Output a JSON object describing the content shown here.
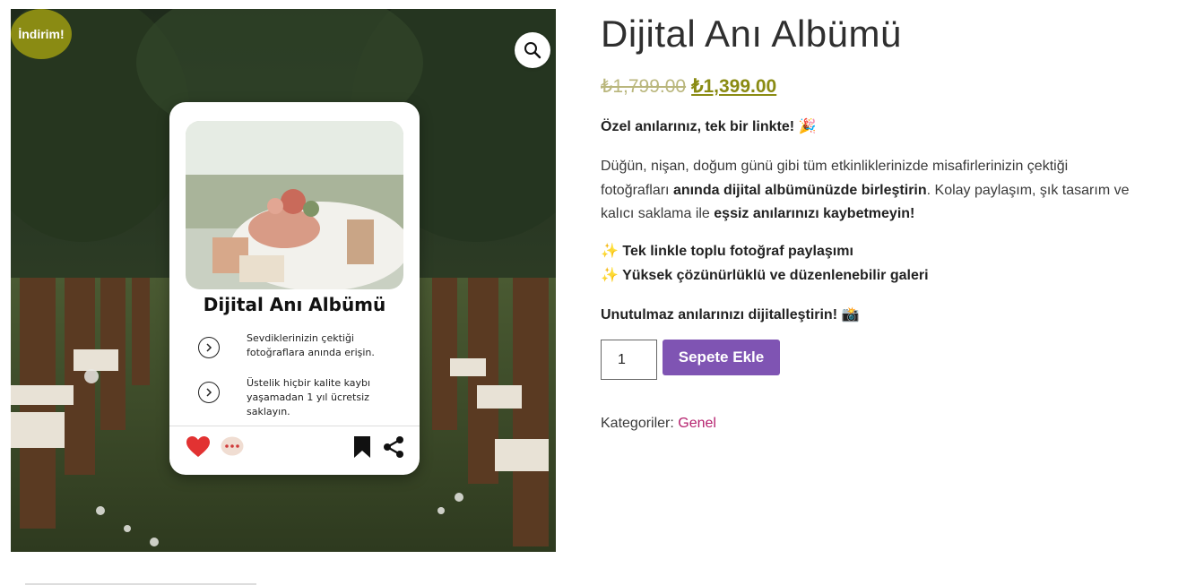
{
  "gallery": {
    "sale_badge": "İndirim!",
    "zoom_icon": "magnifier-icon",
    "card": {
      "title": "Dijital Anı Albümü",
      "features": [
        {
          "icon": "chevron-right-circle-icon",
          "text": "Sevdiklerinizin çektiği fotoğraflara anında erişin."
        },
        {
          "icon": "chevron-right-circle-icon",
          "text": "Üstelik hiçbir kalite kaybı yaşamadan 1 yıl ücretsiz saklayın."
        }
      ],
      "actions": [
        "heart-icon",
        "comment-icon",
        "bookmark-icon",
        "share-icon"
      ]
    }
  },
  "product": {
    "title": "Dijital Anı Albümü",
    "old_price": "₺1,799.00",
    "new_price": "₺1,399.00",
    "tagline": "Özel anılarınız, tek bir linkte! 🎉",
    "description": {
      "part1": "Düğün, nişan, doğum günü gibi tüm etkinliklerinizde misafirlerinizin çektiği fotoğrafları ",
      "bold1": "anında dijital albümünüzde birleştirin",
      "part2": ". Kolay paylaşım, şık tasarım ve kalıcı saklama ile ",
      "bold2": "eşsiz anılarınızı kaybetmeyin!"
    },
    "bullets": [
      "✨ Tek linkle toplu fotoğraf paylaşımı",
      "✨ Yüksek çözünürlüklü ve düzenlenebilir galeri"
    ],
    "closing": "Unutulmaz anılarınızı dijitalleştirin! 📸",
    "quantity": "1",
    "add_to_cart_label": "Sepete Ekle",
    "categories_label": "Kategoriler: ",
    "category": "Genel"
  },
  "colors": {
    "accent_olive": "#8a8b13",
    "button_purple": "#7f54b3",
    "link_pink": "#b5226e"
  }
}
